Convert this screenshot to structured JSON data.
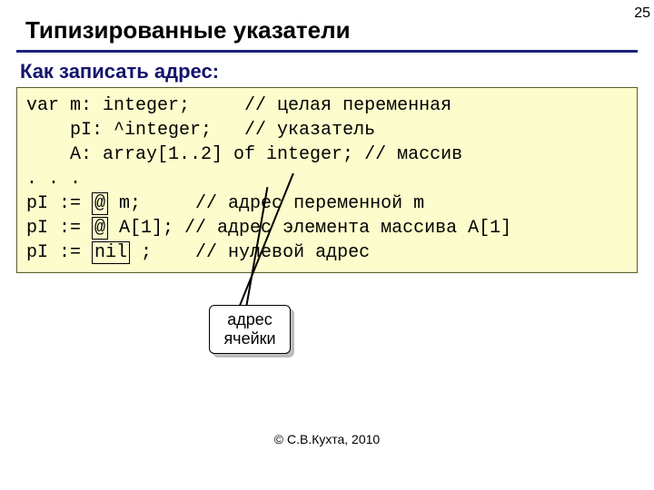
{
  "page_number": "25",
  "title": "Типизированные указатели",
  "subtitle": "Как записать адрес:",
  "code": {
    "l1a": "var m: integer;     ",
    "l1c": "// целая переменная",
    "l2a": "    pI: ^integer;   ",
    "l2c": "// указатель",
    "l3a": "    A: array[1..2] of integer; ",
    "l3c": "// массив",
    "l4": ". . .",
    "l5a": "pI := ",
    "l5h": "@",
    "l5b": " m;     ",
    "l5c": "// адрес переменной m",
    "l6a": "pI := ",
    "l6h": "@",
    "l6b": " A[1]; ",
    "l6c": "// адрес элемента массива A[1]",
    "l7a": "pI := ",
    "l7h": "nil",
    "l7b": " ;    ",
    "l7c": "// нулевой адрес"
  },
  "callout": "адрес\nячейки",
  "footer": "© С.В.Кухта, 2010"
}
